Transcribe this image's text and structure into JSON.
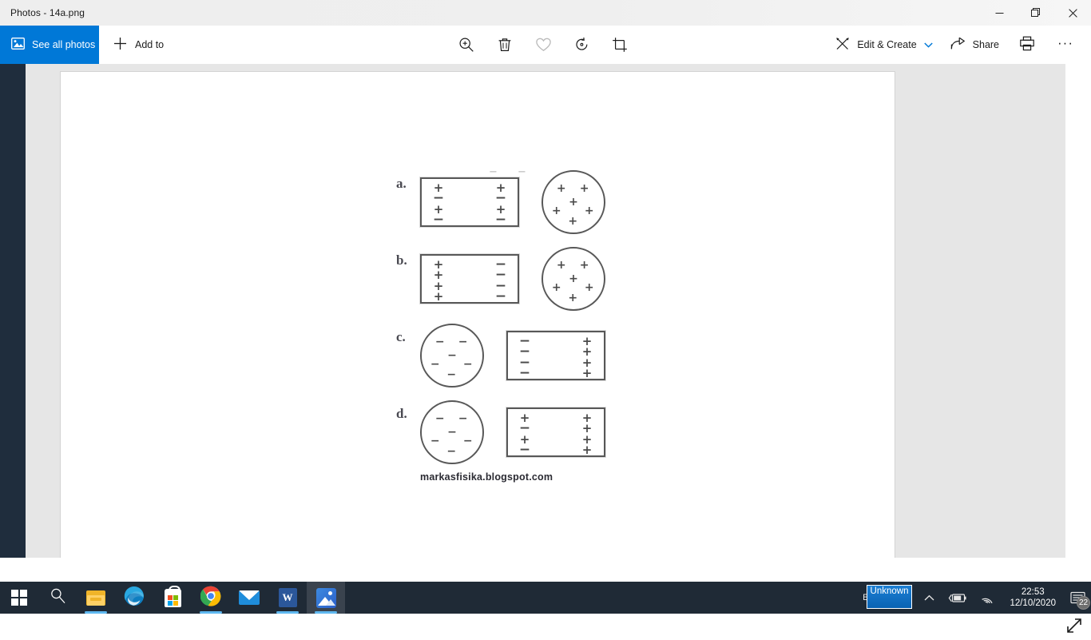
{
  "window": {
    "title": "Photos - 14a.png",
    "controls": {
      "minimize": "minimize-button",
      "restore": "restore-button",
      "close": "close-button"
    }
  },
  "commandbar": {
    "see_all_photos": "See all photos",
    "add_to": "Add to",
    "center_tools": [
      {
        "name": "zoom-icon",
        "label": "Zoom"
      },
      {
        "name": "delete-icon",
        "label": "Delete"
      },
      {
        "name": "heart-icon",
        "label": "Add to favorites"
      },
      {
        "name": "rotate-icon",
        "label": "Rotate"
      },
      {
        "name": "crop-icon",
        "label": "Crop & rotate"
      }
    ],
    "edit_create": "Edit & Create",
    "share": "Share",
    "print": "Print",
    "more": "···"
  },
  "figure": {
    "watermark": "markasfisika.blogspot.com",
    "stray_marks": [
      "−",
      "−"
    ],
    "options": [
      {
        "label": "a.",
        "order": [
          "rect",
          "circle"
        ],
        "rect": {
          "left": [
            "+",
            "−",
            "+",
            "−"
          ],
          "right": [
            "+",
            "−",
            "+",
            "−"
          ]
        },
        "circle": {
          "signs": [
            "+",
            "+",
            "+",
            "+",
            "+",
            "+"
          ]
        }
      },
      {
        "label": "b.",
        "order": [
          "rect",
          "circle"
        ],
        "rect": {
          "left": [
            "+",
            "+",
            "+",
            "+"
          ],
          "right": [
            "−",
            "−",
            "−",
            "−"
          ]
        },
        "circle": {
          "signs": [
            "+",
            "+",
            "+",
            "+",
            "+",
            "+"
          ]
        }
      },
      {
        "label": "c.",
        "order": [
          "circle",
          "rect"
        ],
        "rect": {
          "left": [
            "−",
            "−",
            "−",
            "−"
          ],
          "right": [
            "+",
            "+",
            "+",
            "+"
          ]
        },
        "circle": {
          "signs": [
            "−",
            "−",
            "−",
            "−",
            "−",
            "−"
          ]
        }
      },
      {
        "label": "d.",
        "order": [
          "circle",
          "rect"
        ],
        "rect": {
          "left": [
            "+",
            "−",
            "+",
            "−"
          ],
          "right": [
            "+",
            "+",
            "+",
            "+"
          ]
        },
        "circle": {
          "signs": [
            "−",
            "−",
            "−",
            "−",
            "−",
            "−"
          ]
        }
      }
    ]
  },
  "taskbar": {
    "items": [
      {
        "name": "start-button",
        "label": "Start"
      },
      {
        "name": "search-button",
        "label": "Search"
      },
      {
        "name": "file-explorer-button",
        "label": "File Explorer"
      },
      {
        "name": "edge-button",
        "label": "Microsoft Edge"
      },
      {
        "name": "store-button",
        "label": "Microsoft Store"
      },
      {
        "name": "chrome-button",
        "label": "Google Chrome"
      },
      {
        "name": "mail-button",
        "label": "Mail"
      },
      {
        "name": "word-button",
        "label": "Word"
      },
      {
        "name": "photos-button",
        "label": "Photos"
      }
    ],
    "tray": {
      "language": "EN",
      "tooltip": "Unknown",
      "time": "22:53",
      "date": "12/10/2020",
      "notification_count": "22"
    }
  },
  "colors": {
    "accent": "#0078d7",
    "taskbar": "#1f2a36",
    "rail": "#1f2d3d",
    "canvas": "#e6e6e6",
    "tooltip": "#0b6ec4"
  }
}
